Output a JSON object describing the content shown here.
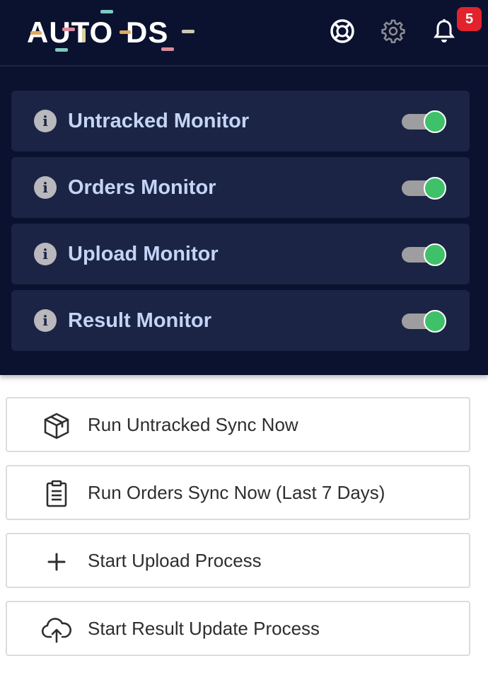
{
  "header": {
    "logo_text": "AUTO-DS",
    "notification_count": "5",
    "icons": [
      "support-icon",
      "gear-icon",
      "bell-icon"
    ]
  },
  "monitors": [
    {
      "label": "Untracked Monitor",
      "enabled": true
    },
    {
      "label": "Orders Monitor",
      "enabled": true
    },
    {
      "label": "Upload Monitor",
      "enabled": true
    },
    {
      "label": "Result Monitor",
      "enabled": true
    }
  ],
  "actions": [
    {
      "label": "Run Untracked Sync Now",
      "icon": "package-icon"
    },
    {
      "label": "Run Orders Sync Now (Last 7 Days)",
      "icon": "clipboard-icon"
    },
    {
      "label": "Start Upload Process",
      "icon": "plus-icon"
    },
    {
      "label": "Start Result Update Process",
      "icon": "cloud-upload-icon"
    }
  ],
  "colors": {
    "header_bg": "#0b1230",
    "card_bg": "#1b2445",
    "label_text": "#c4d4f7",
    "toggle_on": "#3fc16a",
    "badge": "#e2222d"
  }
}
